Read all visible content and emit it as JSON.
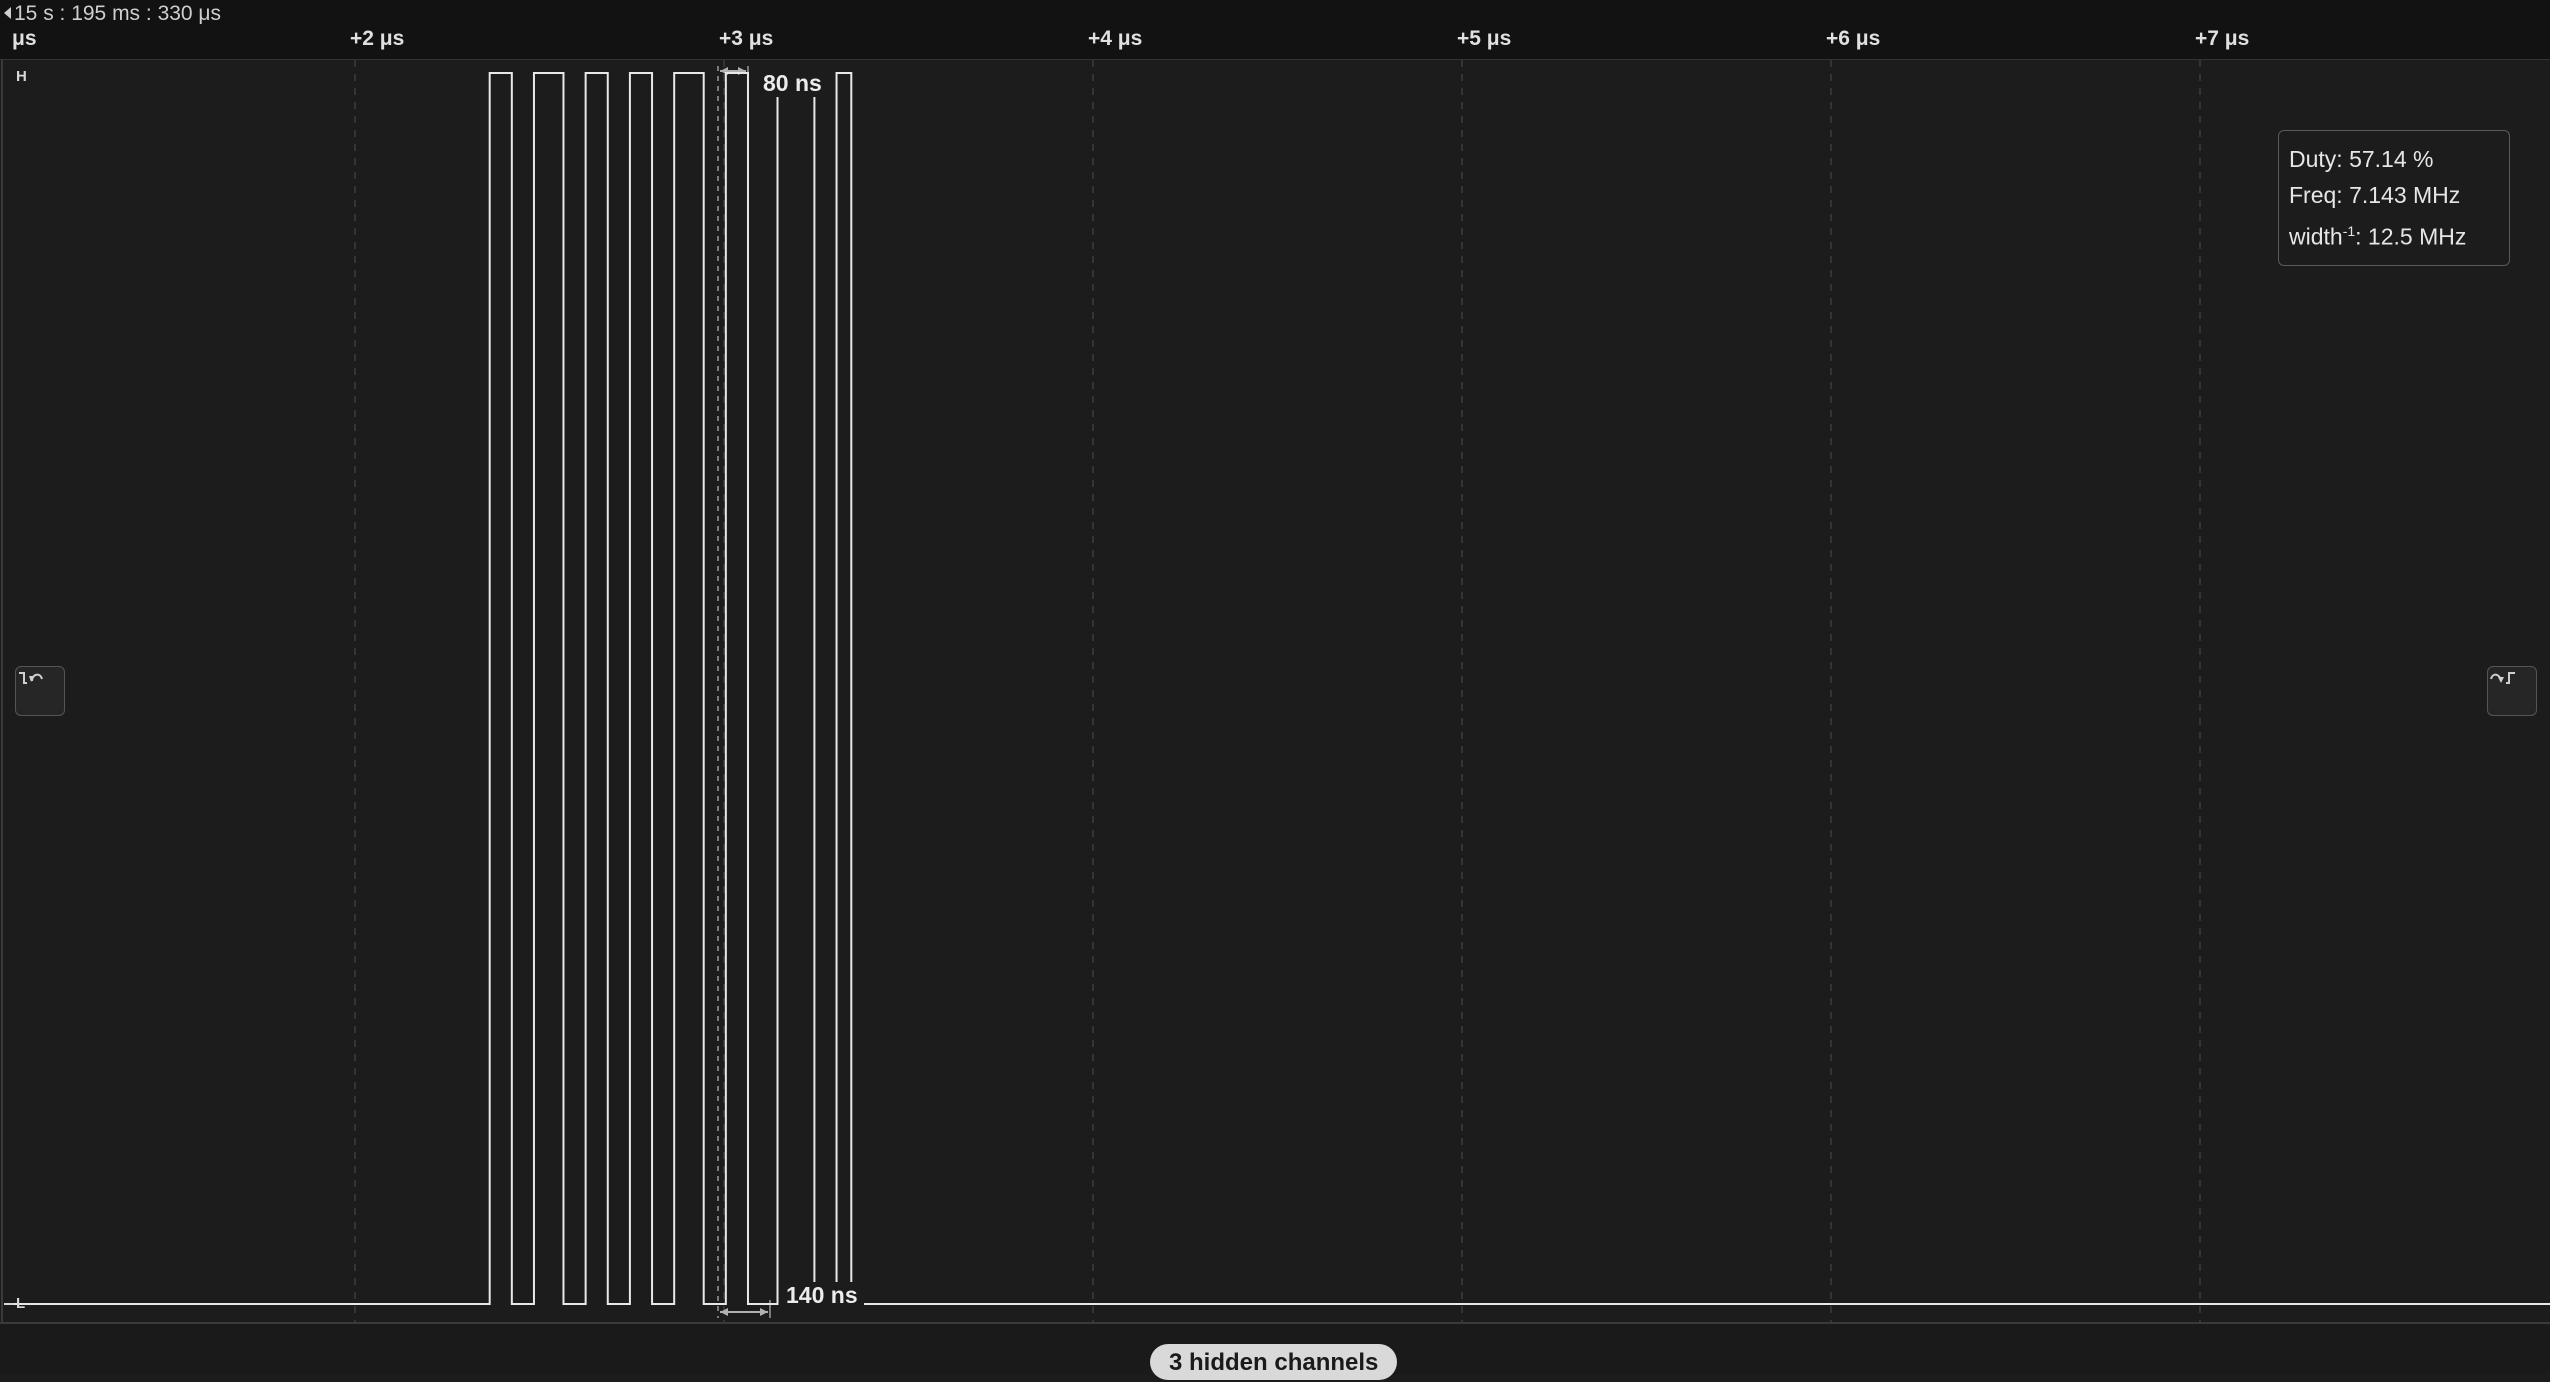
{
  "ruler": {
    "timestamp": "15 s : 195 ms : 330 μs",
    "unit_label": "μs",
    "ticks": [
      "+2 μs",
      "+3 μs",
      "+4 μs",
      "+5 μs",
      "+6 μs",
      "+7 μs"
    ]
  },
  "channel": {
    "high_label": "H",
    "low_label": "L",
    "signal_color": "#e8e8e8",
    "pulses_high_us": [
      [
        1.365,
        1.425
      ],
      [
        1.485,
        1.565
      ],
      [
        1.625,
        1.685
      ],
      [
        1.745,
        1.805
      ],
      [
        1.865,
        1.945
      ],
      [
        2.005,
        2.065
      ],
      [
        2.145,
        2.245
      ],
      [
        2.305,
        2.345
      ]
    ]
  },
  "measurements": {
    "width_label": "80 ns",
    "period_label": "140 ns"
  },
  "stats": {
    "duty": "Duty: 57.14 %",
    "freq": "Freq: 7.143 MHz",
    "width_prefix": "width",
    "width_sup": "-1",
    "width_value": ": 12.5 MHz"
  },
  "nav": {
    "prev_icon": "previous-edge-icon",
    "next_icon": "next-edge-icon"
  },
  "bottom": {
    "hidden_channels": "3 hidden channels"
  }
}
